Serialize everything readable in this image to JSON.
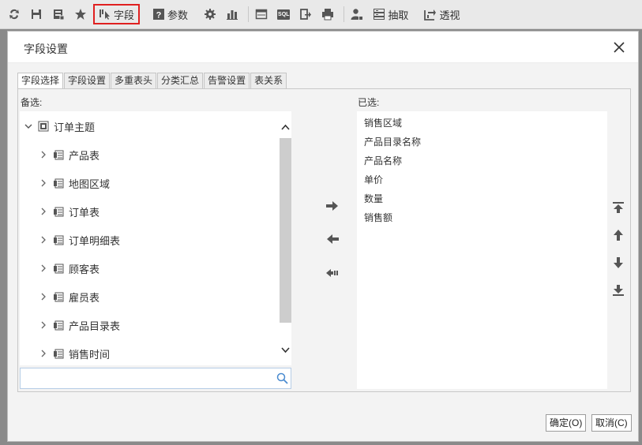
{
  "toolbar": {
    "field_label": "字段",
    "param_label": "参数",
    "extract_label": "抽取",
    "pivot_label": "透视",
    "sql_label": "SQL"
  },
  "dialog": {
    "title": "字段设置",
    "tabs": [
      "字段选择",
      "字段设置",
      "多重表头",
      "分类汇总",
      "告警设置",
      "表关系"
    ],
    "candidates_label": "备选:",
    "selected_label": "已选:",
    "tree": {
      "root": "订单主题",
      "children": [
        "产品表",
        "地图区域",
        "订单表",
        "订单明细表",
        "顾客表",
        "雇员表",
        "产品目录表",
        "销售时间"
      ]
    },
    "search": {
      "value": "",
      "placeholder": ""
    },
    "selected": [
      "销售区域",
      "产品目录名称",
      "产品名称",
      "单价",
      "数量",
      "销售额"
    ],
    "ok_label": "确定(O)",
    "cancel_label": "取消(C)"
  }
}
